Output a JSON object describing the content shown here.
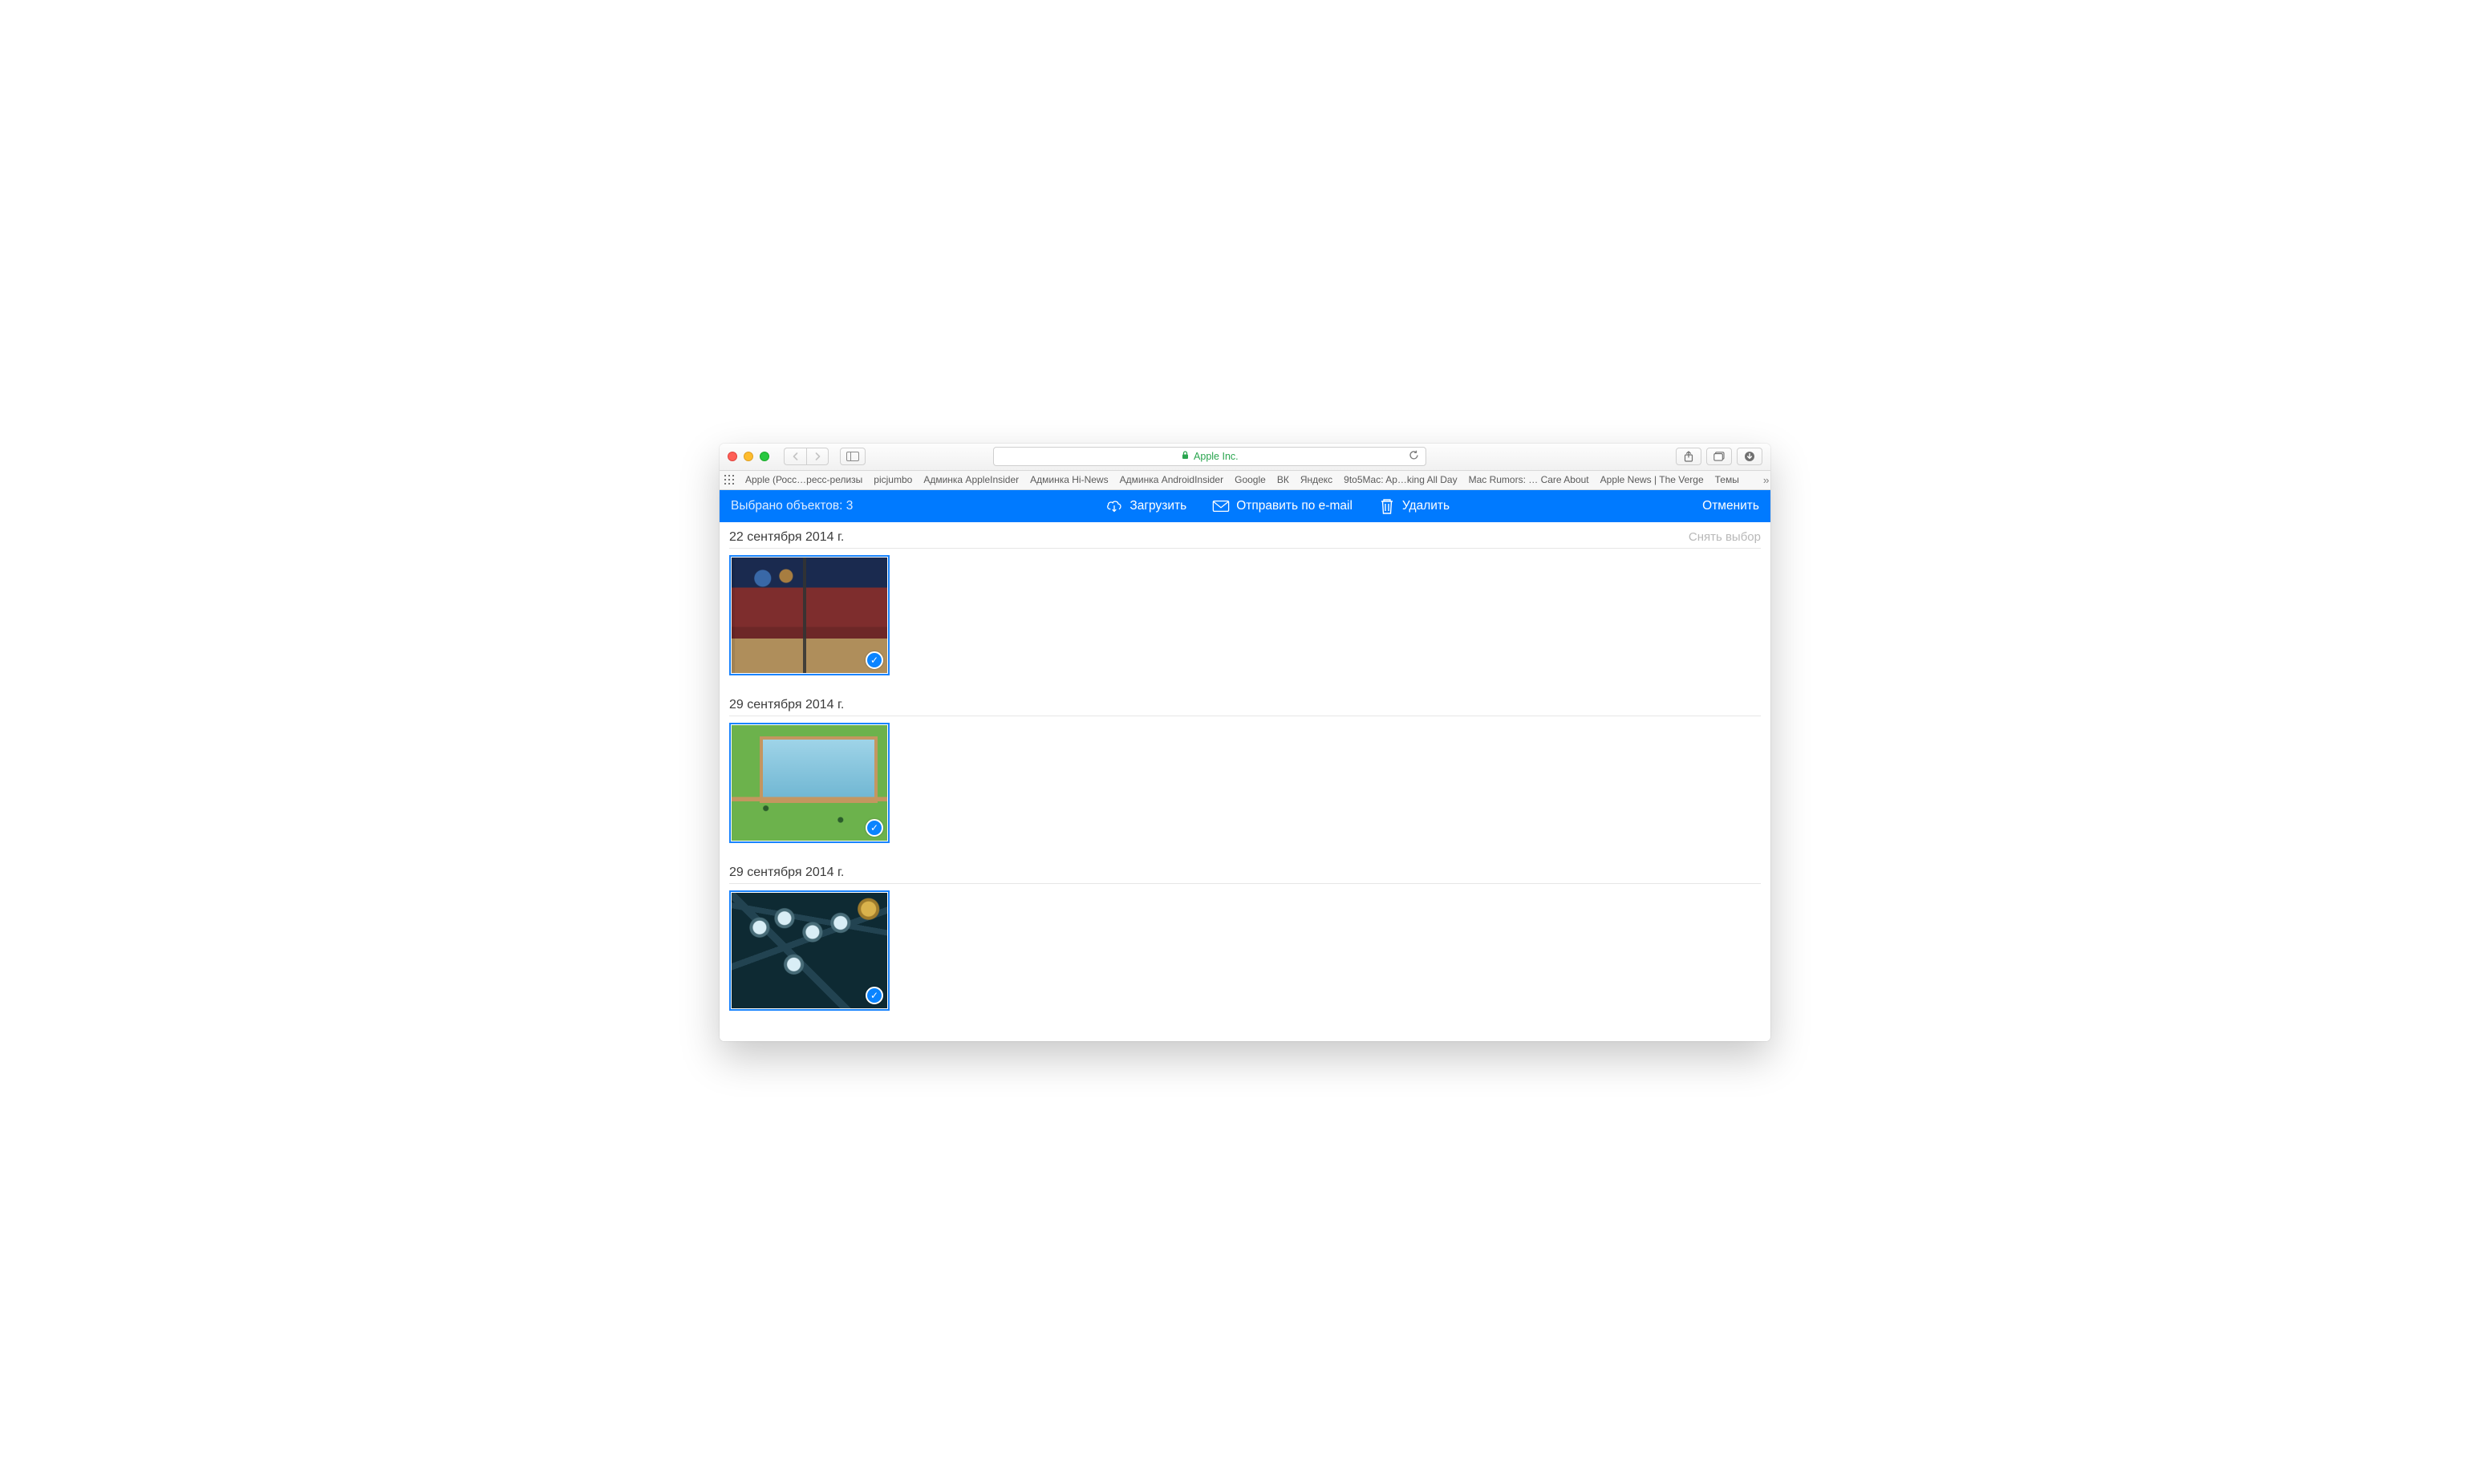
{
  "browser": {
    "url_host": "Apple Inc.",
    "favorites": [
      "Apple (Росс…ресс-релизы",
      "picjumbo",
      "Админка AppleInsider",
      "Админка Hi-News",
      "Админка AndroidInsider",
      "Google",
      "ВК",
      "Яндекс",
      "9to5Mac: Ap…king All Day",
      "Mac Rumors: … Care About",
      "Apple News | The Verge",
      "Темы"
    ]
  },
  "actionbar": {
    "selection_text": "Выбрано объектов: 3",
    "download": "Загрузить",
    "email": "Отправить по e-mail",
    "delete": "Удалить",
    "cancel": "Отменить"
  },
  "groups": [
    {
      "date": "22 сентября 2014 г.",
      "deselect": "Снять выбор",
      "thumb_kind": "room"
    },
    {
      "date": "29 сентября 2014 г.",
      "thumb_kind": "pool"
    },
    {
      "date": "29 сентября 2014 г.",
      "thumb_kind": "night"
    }
  ]
}
